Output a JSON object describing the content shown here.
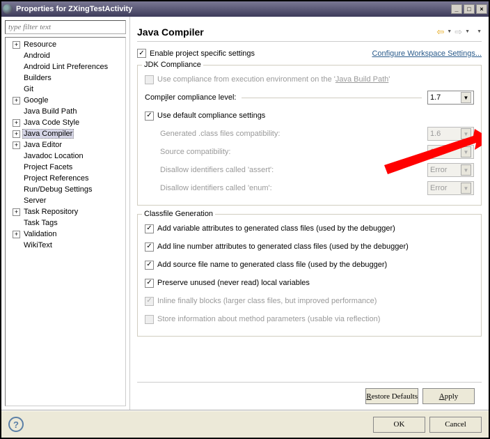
{
  "title": "Properties for ZXingTestActivity",
  "filter_placeholder": "type filter text",
  "tree": [
    {
      "label": "Resource",
      "exp": true
    },
    {
      "label": "Android",
      "exp": false
    },
    {
      "label": "Android Lint Preferences",
      "exp": false
    },
    {
      "label": "Builders",
      "exp": false
    },
    {
      "label": "Git",
      "exp": false
    },
    {
      "label": "Google",
      "exp": true
    },
    {
      "label": "Java Build Path",
      "exp": false
    },
    {
      "label": "Java Code Style",
      "exp": true
    },
    {
      "label": "Java Compiler",
      "exp": true,
      "selected": true
    },
    {
      "label": "Java Editor",
      "exp": true
    },
    {
      "label": "Javadoc Location",
      "exp": false
    },
    {
      "label": "Project Facets",
      "exp": false
    },
    {
      "label": "Project References",
      "exp": false
    },
    {
      "label": "Run/Debug Settings",
      "exp": false
    },
    {
      "label": "Server",
      "exp": false
    },
    {
      "label": "Task Repository",
      "exp": true
    },
    {
      "label": "Task Tags",
      "exp": false
    },
    {
      "label": "Validation",
      "exp": true
    },
    {
      "label": "WikiText",
      "exp": false
    }
  ],
  "page": {
    "title": "Java Compiler",
    "enable_label": "Enable project specific settings",
    "configure_link": "Configure Workspace Settings...",
    "jdk": {
      "title": "JDK Compliance",
      "use_exec_env_pre": "Use compliance from execution environment on the ",
      "use_exec_env_link": "Java Build Path",
      "compliance_label": "Compiler compliance level:",
      "compliance_value": "1.7",
      "use_default_label": "Use default compliance settings",
      "rows": [
        {
          "label": "Generated .class files compatibility:",
          "value": "1.6"
        },
        {
          "label": "Source compatibility:",
          "value": "1.6"
        },
        {
          "label": "Disallow identifiers called 'assert':",
          "value": "Error"
        },
        {
          "label": "Disallow identifiers called 'enum':",
          "value": "Error"
        }
      ]
    },
    "classfile": {
      "title": "Classfile Generation",
      "items": [
        {
          "label": "Add variable attributes to generated class files (used by the debugger)",
          "checked": true,
          "disabled": false
        },
        {
          "label": "Add line number attributes to generated class files (used by the debugger)",
          "checked": true,
          "disabled": false
        },
        {
          "label": "Add source file name to generated class file (used by the debugger)",
          "checked": true,
          "disabled": false
        },
        {
          "label": "Preserve unused (never read) local variables",
          "checked": true,
          "disabled": false
        },
        {
          "label": "Inline finally blocks (larger class files, but improved performance)",
          "checked": true,
          "disabled": true
        },
        {
          "label": "Store information about method parameters (usable via reflection)",
          "checked": false,
          "disabled": true
        }
      ]
    },
    "restore_btn": "Restore Defaults",
    "apply_btn": "Apply"
  },
  "footer": {
    "ok": "OK",
    "cancel": "Cancel"
  }
}
